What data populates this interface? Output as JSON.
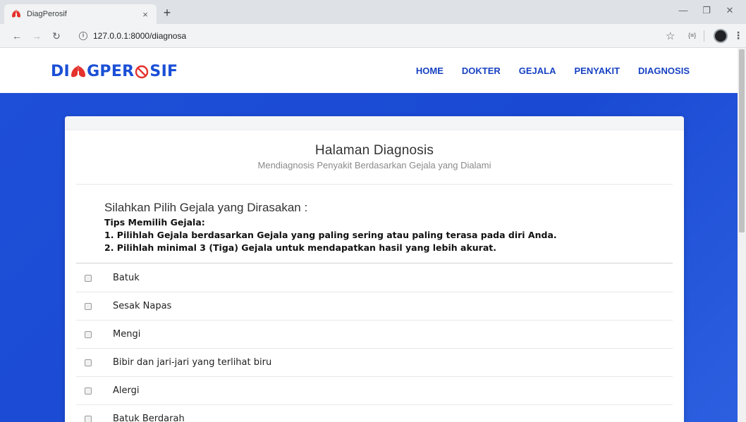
{
  "browser": {
    "tab_title": "DiagPerosif",
    "tab_close": "×",
    "new_tab": "+",
    "url": "127.0.0.1:8000/diagnosa",
    "ext_label": "{≡}"
  },
  "site": {
    "logo_part1": "DI",
    "logo_part2": "GPER",
    "logo_part3": "SIF",
    "nav": [
      "HOME",
      "DOKTER",
      "GEJALA",
      "PENYAKIT",
      "DIAGNOSIS"
    ]
  },
  "card": {
    "title": "Halaman Diagnosis",
    "subtitle": "Mendiagnosis Penyakit Berdasarkan Gejala yang Dialami",
    "question": "Silahkan Pilih Gejala yang Dirasakan :",
    "tips_heading": "Tips Memilih Gejala:",
    "tips": [
      "1. Pilihlah Gejala berdasarkan Gejala yang paling sering atau paling terasa pada diri Anda.",
      "2. Pilihlah minimal 3 (Tiga) Gejala untuk mendapatkan hasil yang lebih akurat."
    ],
    "symptoms": [
      "Batuk",
      "Sesak Napas",
      "Mengi",
      "Bibir dan jari-jari yang terlihat biru",
      "Alergi",
      "Batuk Berdarah"
    ]
  },
  "colors": {
    "brand_blue": "#1a4fd6",
    "brand_red": "#e5322d",
    "hero_blue": "#1e4fd8"
  }
}
